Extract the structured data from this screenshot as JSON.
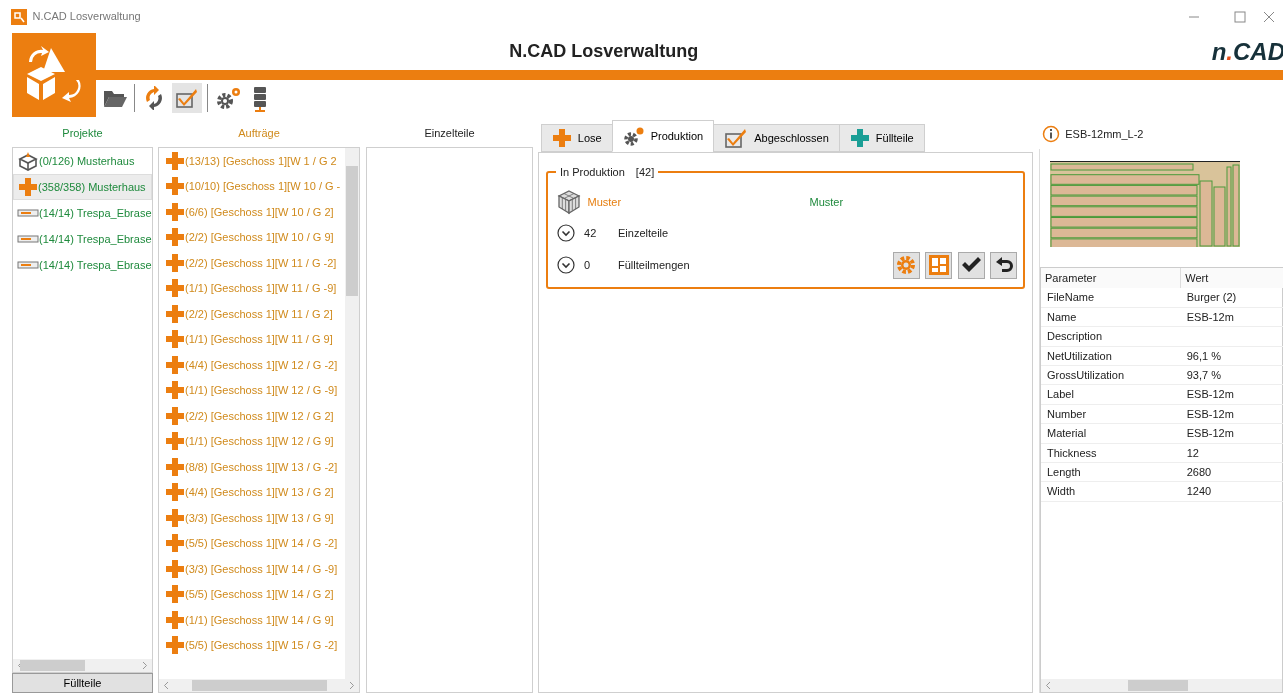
{
  "window": {
    "title": "N.CAD Losverwaltung"
  },
  "header": {
    "title": "N.CAD Losverwaltung",
    "logo": {
      "prefix": "n",
      "dot": ".",
      "suffix": "CAD"
    }
  },
  "toolbar": [
    {
      "kind": "folder",
      "selected": false
    },
    {
      "kind": "sep"
    },
    {
      "kind": "refresh",
      "selected": false
    },
    {
      "kind": "check",
      "selected": true
    },
    {
      "kind": "sep"
    },
    {
      "kind": "gears",
      "selected": false
    },
    {
      "kind": "server",
      "selected": false
    }
  ],
  "projects": {
    "heading": "Projekte",
    "items": [
      {
        "kind": "box",
        "label": "(0/126) Musterhaus",
        "selected": false
      },
      {
        "kind": "plus",
        "label": "(358/358) Musterhaus",
        "selected": true
      },
      {
        "kind": "strip",
        "label": "(14/14) Trespa_Ebrase",
        "selected": false
      },
      {
        "kind": "strip",
        "label": "(14/14) Trespa_Ebrase",
        "selected": false
      },
      {
        "kind": "strip",
        "label": "(14/14) Trespa_Ebrase",
        "selected": false
      }
    ],
    "button": "Füllteile"
  },
  "orders": {
    "heading": "Aufträge",
    "items": [
      "(13/13) [Geschoss 1][W 1 / G 2",
      "(10/10) [Geschoss 1][W 10 / G -",
      "(6/6) [Geschoss 1][W 10 / G 2]",
      "(2/2) [Geschoss 1][W 10 / G 9]",
      "(2/2) [Geschoss 1][W 11 / G -2]",
      "(1/1) [Geschoss 1][W 11 / G -9]",
      "(2/2) [Geschoss 1][W 11 / G 2]",
      "(1/1) [Geschoss 1][W 11 / G 9]",
      "(4/4) [Geschoss 1][W 12 / G -2]",
      "(1/1) [Geschoss 1][W 12 / G -9]",
      "(2/2) [Geschoss 1][W 12 / G 2]",
      "(1/1) [Geschoss 1][W 12 / G 9]",
      "(8/8) [Geschoss 1][W 13 / G -2]",
      "(4/4) [Geschoss 1][W 13 / G 2]",
      "(3/3) [Geschoss 1][W 13 / G 9]",
      "(5/5) [Geschoss 1][W 14 / G -2]",
      "(3/3) [Geschoss 1][W 14 / G -9]",
      "(5/5) [Geschoss 1][W 14 / G 2]",
      "(1/1) [Geschoss 1][W 14 / G 9]",
      "(5/5) [Geschoss 1][W 15 / G -2]"
    ]
  },
  "parts": {
    "heading": "Einzelteile"
  },
  "tabs": [
    {
      "kind": "plus",
      "label": "Lose",
      "selected": false
    },
    {
      "kind": "gear",
      "label": "Produktion",
      "selected": true
    },
    {
      "kind": "check",
      "label": "Abgeschlossen",
      "selected": false
    },
    {
      "kind": "plus-teal",
      "label": "Füllteile",
      "selected": false
    }
  ],
  "group": {
    "title": "In Produktion",
    "count": "[42]",
    "name_left": "Muster",
    "name_right": "Muster",
    "rows": [
      {
        "count": "42",
        "label": "Einzelteile",
        "expanded": false
      },
      {
        "count": "0",
        "label": "Füllteilmengen",
        "expanded": false
      }
    ],
    "actions": [
      {
        "kind": "gear"
      },
      {
        "kind": "layout"
      },
      {
        "kind": "check"
      },
      {
        "kind": "undo"
      }
    ]
  },
  "detail": {
    "title": "ESB-12mm_L-2",
    "columns": [
      "Parameter",
      "Wert"
    ],
    "rows": [
      [
        "FileName",
        "Burger (2)"
      ],
      [
        "Name",
        "ESB-12m"
      ],
      [
        "Description",
        ""
      ],
      [
        "NetUtilization",
        "96,1 %"
      ],
      [
        "GrossUtilization",
        "93,7 %"
      ],
      [
        "Label",
        "ESB-12m"
      ],
      [
        "Number",
        "ESB-12m"
      ],
      [
        "Material",
        "ESB-12m"
      ],
      [
        "Thickness",
        "12"
      ],
      [
        "Length",
        "2680"
      ],
      [
        "Width",
        "1240"
      ]
    ]
  }
}
